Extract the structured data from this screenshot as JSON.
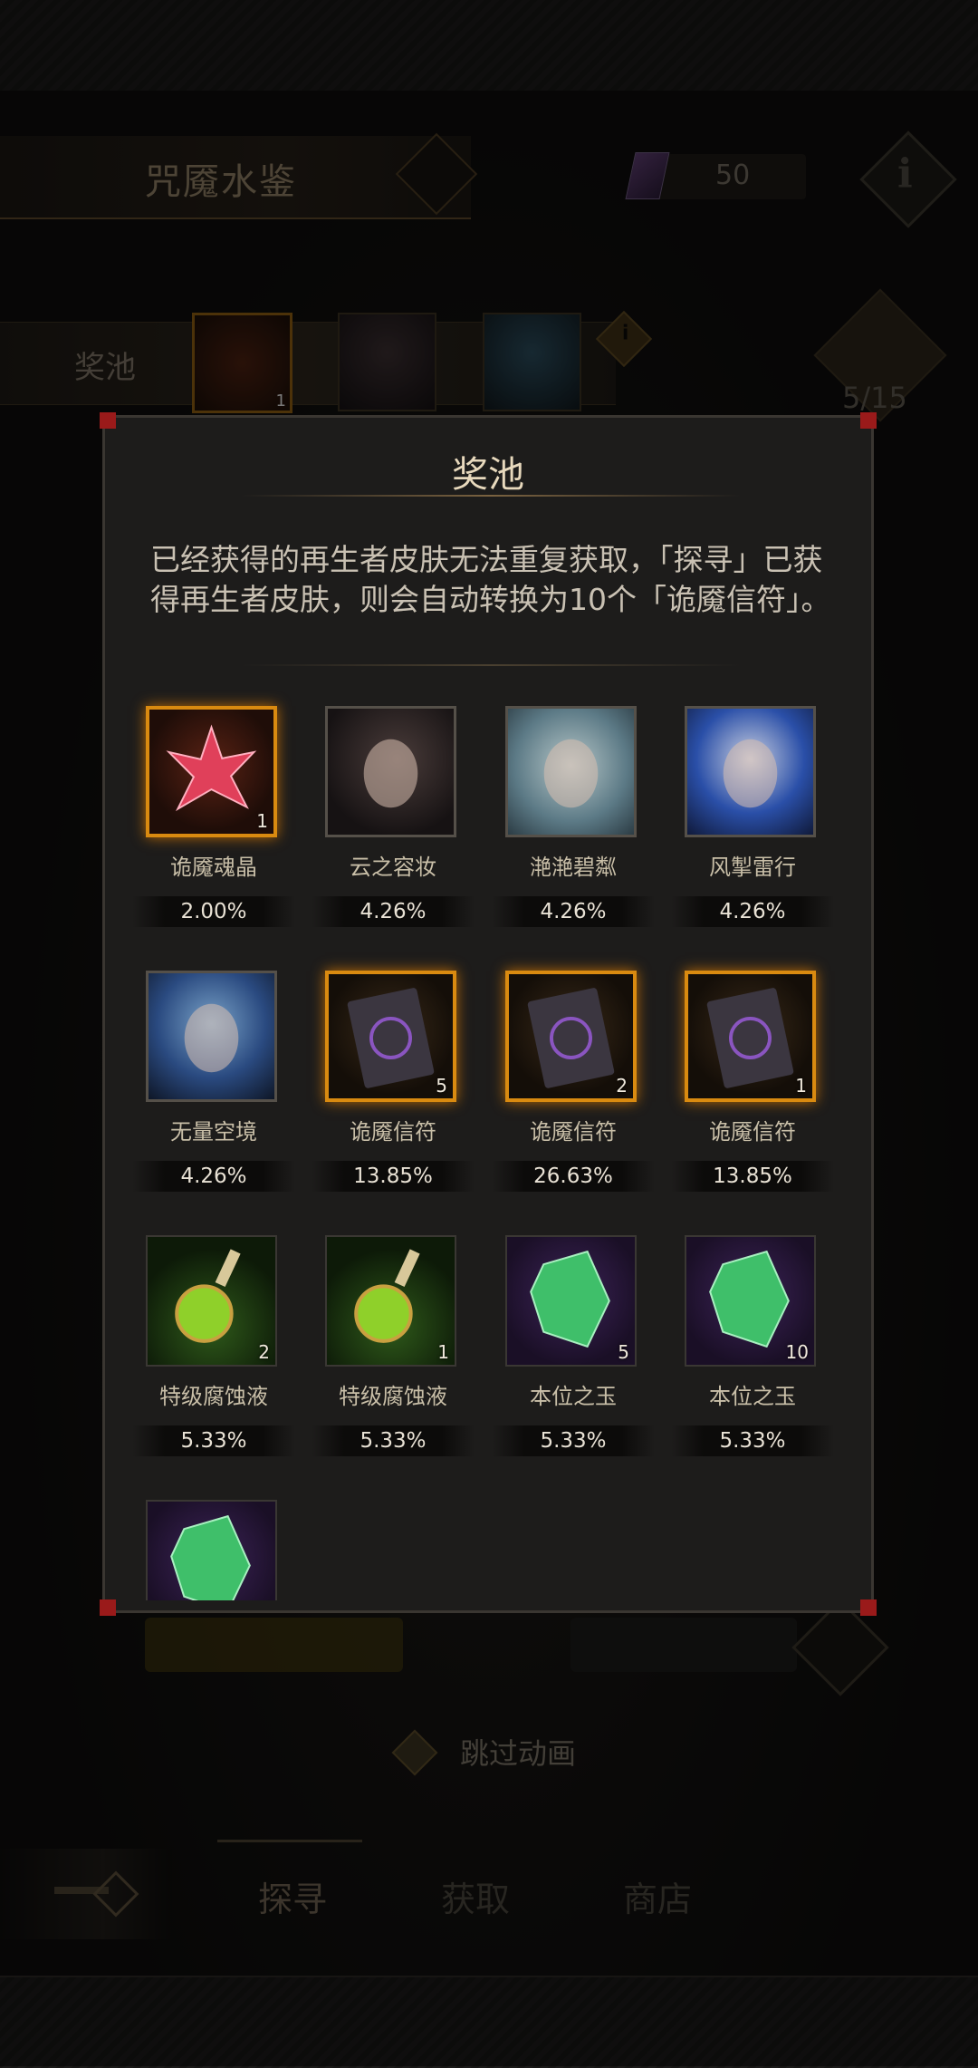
{
  "header": {
    "title": "咒魇水鉴",
    "currency_value": "50"
  },
  "pool_bar": {
    "label": "奖池",
    "thumb1_qty": "1",
    "chest_count": "5/15"
  },
  "skip": {
    "label": "跳过动画"
  },
  "nav": {
    "tabs": [
      "探寻",
      "获取",
      "商店"
    ]
  },
  "dialog": {
    "title": "奖池",
    "description": "已经获得的再生者皮肤无法重复获取，「探寻」已获得再生者皮肤，则会自动转换为10个「诡魇信符」。",
    "items": [
      {
        "name": "诡魇魂晶",
        "rate": "2.00%",
        "qty": "1",
        "icon": "crystal-star-icon",
        "frame": "gold"
      },
      {
        "name": "云之容妆",
        "rate": "4.26%",
        "qty": "",
        "icon": "skin-portrait-icon",
        "frame": "plain"
      },
      {
        "name": "滟滟碧粼",
        "rate": "4.26%",
        "qty": "",
        "icon": "skin-portrait-icon",
        "frame": "plain"
      },
      {
        "name": "风掣雷行",
        "rate": "4.26%",
        "qty": "",
        "icon": "skin-portrait-icon",
        "frame": "plain"
      },
      {
        "name": "无量空境",
        "rate": "4.26%",
        "qty": "",
        "icon": "skin-portrait-icon",
        "frame": "plain"
      },
      {
        "name": "诡魇信符",
        "rate": "13.85%",
        "qty": "5",
        "icon": "sigil-card-icon",
        "frame": "gold"
      },
      {
        "name": "诡魇信符",
        "rate": "26.63%",
        "qty": "2",
        "icon": "sigil-card-icon",
        "frame": "gold"
      },
      {
        "name": "诡魇信符",
        "rate": "13.85%",
        "qty": "1",
        "icon": "sigil-card-icon",
        "frame": "gold"
      },
      {
        "name": "特级腐蚀液",
        "rate": "5.33%",
        "qty": "2",
        "icon": "potion-bottle-icon",
        "frame": "green"
      },
      {
        "name": "特级腐蚀液",
        "rate": "5.33%",
        "qty": "1",
        "icon": "potion-bottle-icon",
        "frame": "green"
      },
      {
        "name": "本位之玉",
        "rate": "5.33%",
        "qty": "5",
        "icon": "jade-gem-icon",
        "frame": "purple"
      },
      {
        "name": "本位之玉",
        "rate": "5.33%",
        "qty": "10",
        "icon": "jade-gem-icon",
        "frame": "purple"
      },
      {
        "name": "",
        "rate": "",
        "qty": "",
        "icon": "jade-gem-icon",
        "frame": "purple"
      }
    ]
  },
  "colors": {
    "gold_frame": "#d98a10",
    "panel_bg": "#1d1c1b",
    "corner_red": "#9a1a1a"
  }
}
